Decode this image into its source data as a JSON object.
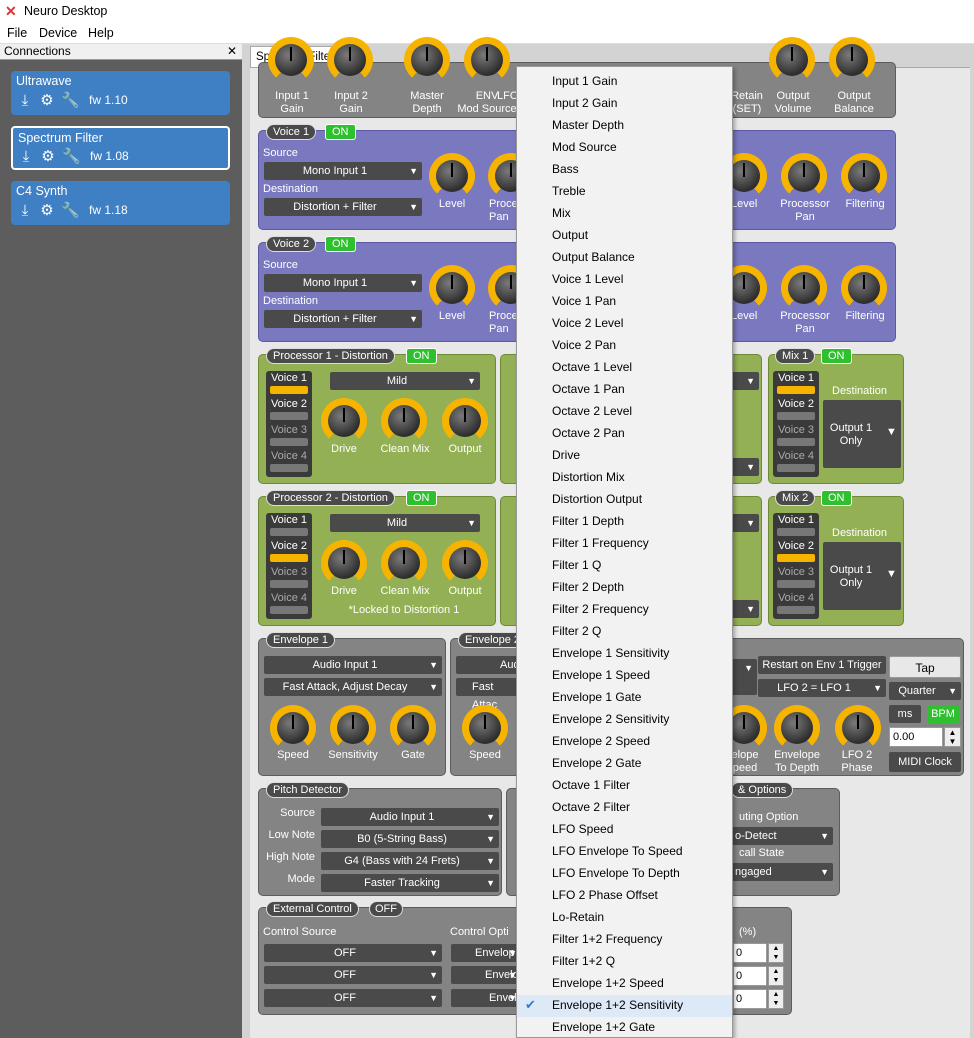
{
  "window": {
    "title": "Neuro Desktop"
  },
  "menubar": [
    "File",
    "Device",
    "Help"
  ],
  "connections": {
    "header": "Connections",
    "devices": [
      {
        "name": "Ultrawave",
        "fw": "fw 1.10"
      },
      {
        "name": "Spectrum Filter",
        "fw": "fw 1.08"
      },
      {
        "name": "C4 Synth",
        "fw": "fw 1.18"
      }
    ]
  },
  "tab": {
    "label": "Spectrum Filter"
  },
  "top_knobs": [
    "Input 1\nGain",
    "Input 2\nGain",
    "Master\nDepth",
    "ENV\nMod Source",
    "LFO",
    "Retain\n(SET)",
    "Output\nVolume",
    "Output\nBalance"
  ],
  "voice1": {
    "label": "Voice 1",
    "on": "ON",
    "source_label": "Source",
    "source": "Mono Input 1",
    "dest_label": "Destination",
    "dest": "Distortion + Filter",
    "knobs": [
      "Level",
      "Processor\nPan",
      "Level",
      "Processor\nPan",
      "Filtering"
    ]
  },
  "voice2": {
    "label": "Voice 2",
    "on": "ON",
    "source_label": "Source",
    "source": "Mono Input 1",
    "dest_label": "Destination",
    "dest": "Distortion + Filter",
    "knobs": [
      "Level",
      "Processor\nPan",
      "Level",
      "Processor\nPan",
      "Filtering"
    ]
  },
  "proc1": {
    "label": "Processor 1 - Distortion",
    "on": "ON",
    "mode": "Mild",
    "voices": [
      "Voice 1",
      "Voice 2",
      "Voice 3",
      "Voice 4"
    ],
    "knobs": [
      "Drive",
      "Clean Mix",
      "Output"
    ]
  },
  "proc2": {
    "label": "Processor 2 - Distortion",
    "on": "ON",
    "mode": "Mild",
    "voices": [
      "Voice 1",
      "Voice 2",
      "Voice 3",
      "Voice 4"
    ],
    "knobs": [
      "Drive",
      "Clean Mix",
      "Output"
    ],
    "note": "*Locked to Distortion 1"
  },
  "mix1": {
    "label": "Mix 1",
    "on": "ON",
    "dest_label": "Destination",
    "dest": "Output 1\nOnly"
  },
  "mix2": {
    "label": "Mix 2",
    "on": "ON",
    "dest_label": "Destination",
    "dest": "Output 1\nOnly"
  },
  "envelope1": {
    "label": "Envelope 1",
    "input": "Audio Input 1",
    "mode": "Fast Attack, Adjust Decay",
    "knobs": [
      "Speed",
      "Sensitivity",
      "Gate"
    ]
  },
  "envelope2": {
    "label": "Envelope 2",
    "input": "Audi",
    "mode": "Fast Attac",
    "knobs": [
      "Speed"
    ]
  },
  "lfo": {
    "restart": "Restart on Env 1 Trigger",
    "lfo2": "LFO 2 = LFO 1",
    "tap": "Tap",
    "quarter": "Quarter",
    "ms": "ms",
    "bpm": "BPM",
    "value": "0.00",
    "midi": "MIDI Clock",
    "knobs": [
      "elope\npeed",
      "Envelope\nTo Depth",
      "LFO 2\nPhase"
    ]
  },
  "pitch": {
    "label": "Pitch Detector",
    "source_l": "Source",
    "source": "Audio Input 1",
    "low_l": "Low Note",
    "low": "B0 (5-String Bass)",
    "high_l": "High Note",
    "high": "G4 (Bass with 24 Frets)",
    "mode_l": "Mode",
    "mode": "Faster Tracking"
  },
  "options": {
    "label": "& Options",
    "routing_l": "uting Option",
    "routing": "o-Detect",
    "recall_l": "call State",
    "recall": "ngaged"
  },
  "extctrl": {
    "label": "External Control",
    "off": "OFF",
    "source_l": "Control Source",
    "opt_l": "Control Opti",
    "sources": [
      "OFF",
      "OFF",
      "OFF"
    ],
    "opts": [
      "Envelop",
      "Envelo",
      "Envel"
    ],
    "pct_l": "(%)",
    "pcts": [
      "0",
      "0",
      "0"
    ]
  },
  "menu": {
    "items": [
      "Input 1 Gain",
      "Input 2 Gain",
      "Master Depth",
      "Mod Source",
      "Bass",
      "Treble",
      "Mix",
      "Output",
      "Output Balance",
      "Voice 1 Level",
      "Voice 1 Pan",
      "Voice 2 Level",
      "Voice 2 Pan",
      "Octave 1 Level",
      "Octave 1 Pan",
      "Octave 2 Level",
      "Octave 2 Pan",
      "Drive",
      "Distortion Mix",
      "Distortion Output",
      "Filter 1 Depth",
      "Filter 1 Frequency",
      "Filter 1 Q",
      "Filter 2 Depth",
      "Filter 2 Frequency",
      "Filter 2 Q",
      "Envelope 1 Sensitivity",
      "Envelope 1 Speed",
      "Envelope 1 Gate",
      "Envelope 2 Sensitivity",
      "Envelope 2 Speed",
      "Envelope 2 Gate",
      "Octave 1 Filter",
      "Octave 2 Filter",
      "LFO Speed",
      "LFO Envelope To Speed",
      "LFO Envelope To Depth",
      "LFO 2 Phase Offset",
      "Lo-Retain",
      "Filter 1+2 Frequency",
      "Filter 1+2 Q",
      "Envelope 1+2 Speed",
      "Envelope 1+2 Sensitivity",
      "Envelope 1+2 Gate"
    ],
    "checked_index": 42
  },
  "colors": {
    "accent": "#f6b400",
    "device": "#3f7fc4",
    "voice": "#7a78bf",
    "proc": "#93b054"
  }
}
